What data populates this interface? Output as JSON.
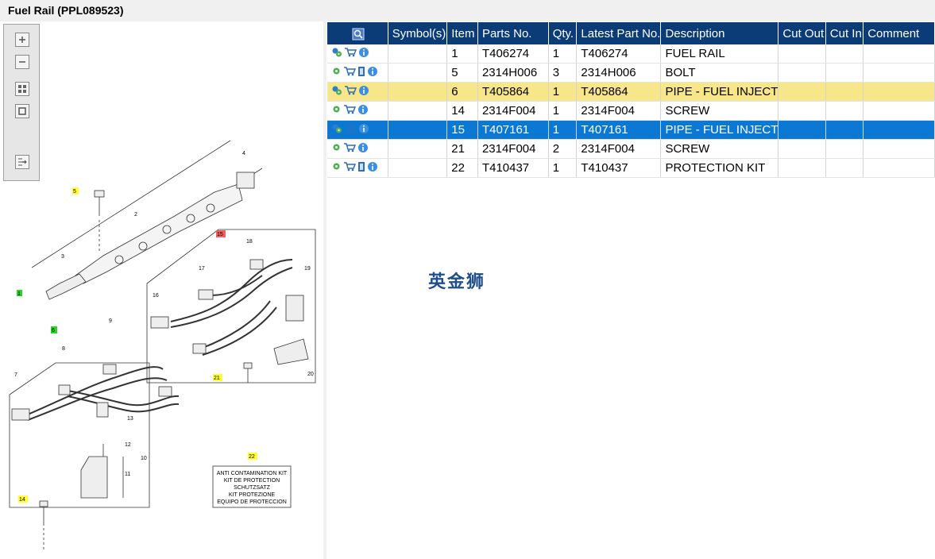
{
  "window": {
    "title": "Fuel Rail (PPL089523)"
  },
  "toolbar": {
    "buttons": [
      {
        "name": "zoom-in-icon"
      },
      {
        "name": "zoom-out-icon"
      },
      {
        "name": "fit-all-icon"
      },
      {
        "name": "fit-window-icon"
      },
      {
        "name": "export-icon"
      }
    ]
  },
  "diagram": {
    "callouts": [
      "1",
      "2",
      "3",
      "4",
      "5",
      "6",
      "7",
      "8",
      "9",
      "10",
      "11",
      "12",
      "13",
      "14",
      "15",
      "16",
      "17",
      "18",
      "19",
      "20",
      "21",
      "22"
    ],
    "kit_text": [
      "ANTI CONTAMINATION KIT",
      "KIT DE PROTECTION",
      "SCHUTZSATZ",
      "KIT PROTEZIONE",
      "EQUIPO DE PROTECCION"
    ]
  },
  "grid": {
    "columns": [
      "",
      "Symbol(s)",
      "Item",
      "Parts No.",
      "Qty.",
      "Latest Part No.",
      "Description",
      "Cut Out",
      "Cut In",
      "Comment"
    ],
    "rows": [
      {
        "icons": [
          "gear-multi-icon",
          "cart-icon",
          "info-icon"
        ],
        "symbol": "",
        "item": "1",
        "part": "T406274",
        "qty": "1",
        "latest": "T406274",
        "desc": "FUEL RAIL",
        "cutout": "",
        "cutin": "",
        "comment": "",
        "state": "normal"
      },
      {
        "icons": [
          "gear-icon",
          "cart-icon",
          "book-icon",
          "info-icon"
        ],
        "symbol": "",
        "item": "5",
        "part": "2314H006",
        "qty": "3",
        "latest": "2314H006",
        "desc": "BOLT",
        "cutout": "",
        "cutin": "",
        "comment": "",
        "state": "normal"
      },
      {
        "icons": [
          "gear-multi-icon",
          "cart-icon",
          "info-icon"
        ],
        "symbol": "",
        "item": "6",
        "part": "T405864",
        "qty": "1",
        "latest": "T405864",
        "desc": "PIPE - FUEL INJECT",
        "cutout": "",
        "cutin": "",
        "comment": "",
        "state": "highlight"
      },
      {
        "icons": [
          "gear-icon",
          "cart-icon",
          "info-icon"
        ],
        "symbol": "",
        "item": "14",
        "part": "2314F004",
        "qty": "1",
        "latest": "2314F004",
        "desc": "SCREW",
        "cutout": "",
        "cutin": "",
        "comment": "",
        "state": "normal"
      },
      {
        "icons": [
          "gear-multi-icon",
          "cart-icon",
          "info-icon"
        ],
        "symbol": "",
        "item": "15",
        "part": "T407161",
        "qty": "1",
        "latest": "T407161",
        "desc": "PIPE - FUEL INJECT",
        "cutout": "",
        "cutin": "",
        "comment": "",
        "state": "selected"
      },
      {
        "icons": [
          "gear-icon",
          "cart-icon",
          "info-icon"
        ],
        "symbol": "",
        "item": "21",
        "part": "2314F004",
        "qty": "2",
        "latest": "2314F004",
        "desc": "SCREW",
        "cutout": "",
        "cutin": "",
        "comment": "",
        "state": "normal"
      },
      {
        "icons": [
          "gear-icon",
          "cart-icon",
          "book-icon",
          "info-icon"
        ],
        "symbol": "",
        "item": "22",
        "part": "T410437",
        "qty": "1",
        "latest": "T410437",
        "desc": "PROTECTION KIT",
        "cutout": "",
        "cutin": "",
        "comment": "",
        "state": "normal"
      }
    ]
  },
  "watermark": "英金狮",
  "colors": {
    "header": "#0b3c78",
    "selected": "#0b78d4",
    "highlight": "#f8e68a"
  }
}
